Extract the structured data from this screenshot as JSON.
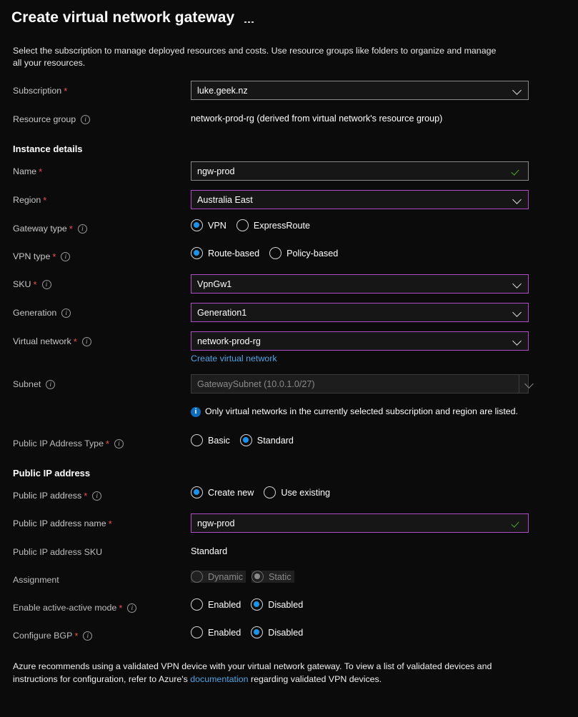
{
  "header": {
    "title": "Create virtual network gateway",
    "more_menu": "…"
  },
  "intro": "Select the subscription to manage deployed resources and costs. Use resource groups like folders to organize and manage all your resources.",
  "project_details": {
    "subscription": {
      "label": "Subscription",
      "required": "*",
      "value": "luke.geek.nz"
    },
    "resource_group": {
      "label": "Resource group",
      "value": "network-prod-rg (derived from virtual network's resource group)"
    }
  },
  "instance_details": {
    "heading": "Instance details",
    "name": {
      "label": "Name",
      "required": "*",
      "value": "ngw-prod"
    },
    "region": {
      "label": "Region",
      "required": "*",
      "value": "Australia East"
    },
    "gateway_type": {
      "label": "Gateway type",
      "required": "*",
      "options": [
        "VPN",
        "ExpressRoute"
      ],
      "selected": "VPN"
    },
    "vpn_type": {
      "label": "VPN type",
      "required": "*",
      "options": [
        "Route-based",
        "Policy-based"
      ],
      "selected": "Route-based"
    },
    "sku": {
      "label": "SKU",
      "required": "*",
      "value": "VpnGw1"
    },
    "generation": {
      "label": "Generation",
      "value": "Generation1"
    },
    "virtual_network": {
      "label": "Virtual network",
      "required": "*",
      "value": "network-prod-rg",
      "create_link": "Create virtual network"
    },
    "subnet": {
      "label": "Subnet",
      "value": "GatewaySubnet (10.0.1.0/27)",
      "disabled": true
    },
    "vnet_info_message": "Only virtual networks in the currently selected subscription and region are listed.",
    "public_ip_address_type": {
      "label": "Public IP Address Type",
      "required": "*",
      "options": [
        "Basic",
        "Standard"
      ],
      "selected": "Standard"
    }
  },
  "public_ip_address": {
    "heading": "Public IP address",
    "public_ip_address": {
      "label": "Public IP address",
      "required": "*",
      "options": [
        "Create new",
        "Use existing"
      ],
      "selected": "Create new"
    },
    "public_ip_address_name": {
      "label": "Public IP address name",
      "required": "*",
      "value": "ngw-prod"
    },
    "public_ip_address_sku": {
      "label": "Public IP address SKU",
      "value": "Standard"
    },
    "assignment": {
      "label": "Assignment",
      "options": [
        "Dynamic",
        "Static"
      ],
      "selected": "Static",
      "disabled": true
    },
    "active_active": {
      "label": "Enable active-active mode",
      "required": "*",
      "options": [
        "Enabled",
        "Disabled"
      ],
      "selected": "Disabled"
    },
    "configure_bgp": {
      "label": "Configure BGP",
      "required": "*",
      "options": [
        "Enabled",
        "Disabled"
      ],
      "selected": "Disabled"
    }
  },
  "footer": {
    "text_before": "Azure recommends using a validated VPN device with your virtual network gateway. To view a list of validated devices and instructions for configuration, refer to Azure's ",
    "link": "documentation",
    "text_after": " regarding validated VPN devices."
  },
  "colors": {
    "accent_blue": "#1b93eb",
    "focus_purple": "#b14ac9",
    "required_red": "#e8534f",
    "link_blue": "#4fa3e3",
    "valid_green": "#4ea82a",
    "info_blue": "#0f6cbd",
    "background": "#0b0b0b"
  }
}
